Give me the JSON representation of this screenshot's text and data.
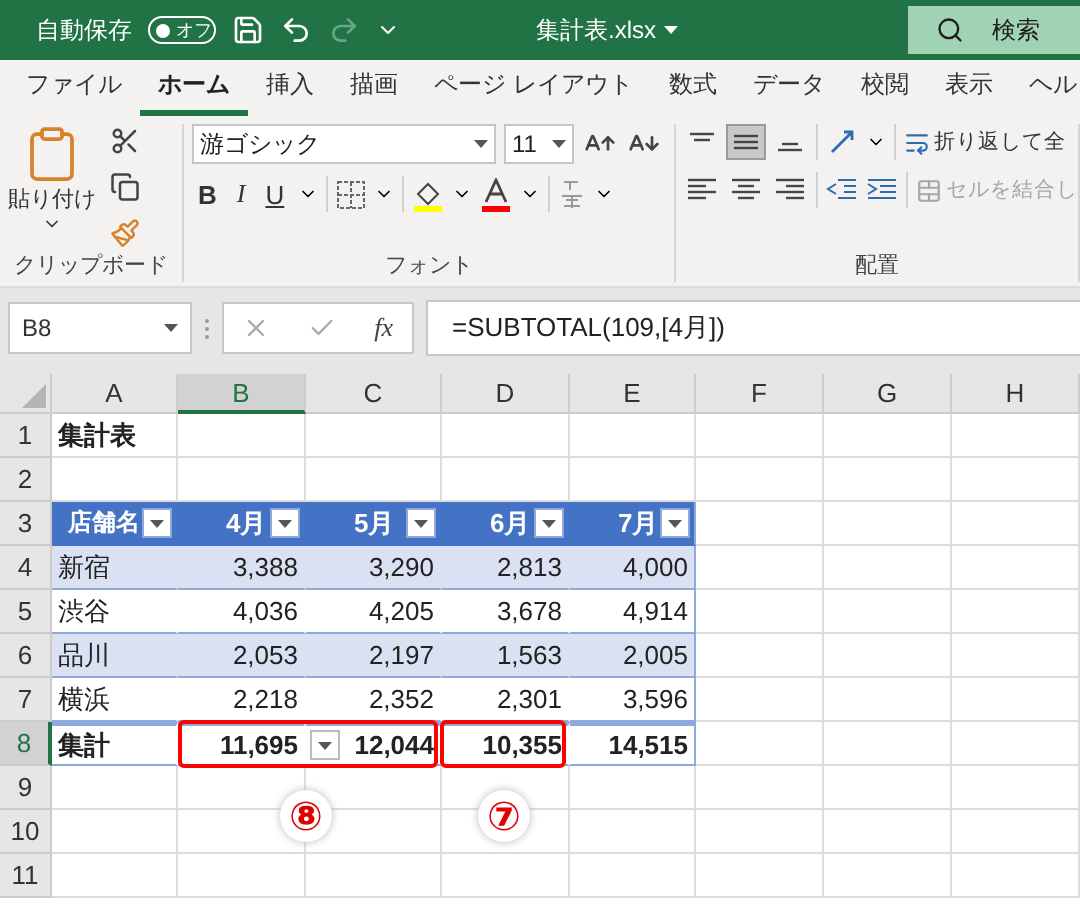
{
  "title_bar": {
    "autosave": {
      "label": "自動保存",
      "toggle_text": "オフ",
      "on": false
    },
    "file_name": "集計表.xlsx",
    "search_label": "検索"
  },
  "ribbon_tabs": [
    {
      "label": "ファイル",
      "selected": false
    },
    {
      "label": "ホーム",
      "selected": true
    },
    {
      "label": "挿入",
      "selected": false
    },
    {
      "label": "描画",
      "selected": false
    },
    {
      "label": "ページ レイアウト",
      "selected": false
    },
    {
      "label": "数式",
      "selected": false
    },
    {
      "label": "データ",
      "selected": false
    },
    {
      "label": "校閲",
      "selected": false
    },
    {
      "label": "表示",
      "selected": false
    },
    {
      "label": "ヘル",
      "selected": false
    }
  ],
  "ribbon": {
    "clipboard": {
      "paste_label": "貼り付け",
      "group_label": "クリップボード"
    },
    "font": {
      "font_name": "游ゴシック",
      "font_size": "11",
      "bold_label": "B",
      "italic_label": "I",
      "underline_label": "U",
      "group_label": "フォント"
    },
    "alignment": {
      "middle_align_selected": true,
      "wrap_text_label": "折り返して全",
      "merge_label": "セルを結合し",
      "merge_disabled": true,
      "group_label": "配置"
    }
  },
  "formula_bar": {
    "name_box": "B8",
    "fx_label": "fx",
    "formula": "=SUBTOTAL(109,[4月])"
  },
  "sheet": {
    "columns": [
      {
        "label": "A",
        "selected": false
      },
      {
        "label": "B",
        "selected": true
      },
      {
        "label": "C",
        "selected": false
      },
      {
        "label": "D",
        "selected": false
      },
      {
        "label": "E",
        "selected": false
      },
      {
        "label": "F",
        "selected": false
      },
      {
        "label": "G",
        "selected": false
      },
      {
        "label": "H",
        "selected": false
      }
    ],
    "rows": [
      {
        "number": "1",
        "selected": false,
        "kind": "title",
        "cells": [
          "集計表"
        ]
      },
      {
        "number": "2",
        "selected": false,
        "kind": "blank"
      },
      {
        "number": "3",
        "selected": false,
        "kind": "header",
        "cells": [
          "店舗名",
          "4月",
          "5月",
          "6月",
          "7月"
        ]
      },
      {
        "number": "4",
        "selected": false,
        "kind": "data",
        "banded": true,
        "cells": [
          "新宿",
          "3,388",
          "3,290",
          "2,813",
          "4,000"
        ]
      },
      {
        "number": "5",
        "selected": false,
        "kind": "data",
        "banded": false,
        "cells": [
          "渋谷",
          "4,036",
          "4,205",
          "3,678",
          "4,914"
        ]
      },
      {
        "number": "6",
        "selected": false,
        "kind": "data",
        "banded": true,
        "cells": [
          "品川",
          "2,053",
          "2,197",
          "1,563",
          "2,005"
        ]
      },
      {
        "number": "7",
        "selected": false,
        "kind": "data",
        "banded": false,
        "cells": [
          "横浜",
          "2,218",
          "2,352",
          "2,301",
          "3,596"
        ]
      },
      {
        "number": "8",
        "selected": true,
        "kind": "total",
        "cells": [
          "集計",
          "11,695",
          "12,044",
          "10,355",
          "14,515"
        ]
      },
      {
        "number": "9",
        "selected": false,
        "kind": "blank"
      },
      {
        "number": "10",
        "selected": false,
        "kind": "blank"
      },
      {
        "number": "11",
        "selected": false,
        "kind": "blank"
      }
    ]
  },
  "callouts": [
    {
      "label": "⑧"
    },
    {
      "label": "⑦"
    }
  ]
}
